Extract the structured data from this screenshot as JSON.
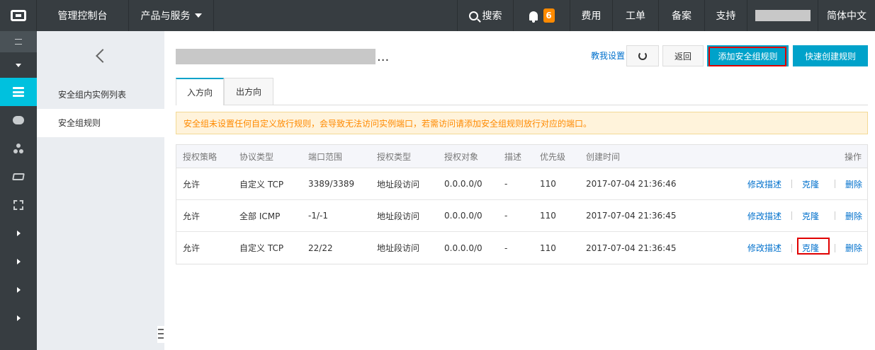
{
  "topbar": {
    "console": "管理控制台",
    "products": "产品与服务",
    "search": "搜索",
    "notification_count": "6",
    "fee": "费用",
    "ticket": "工单",
    "record": "备案",
    "support": "支持",
    "language": "简体中文"
  },
  "subnav": {
    "items": [
      {
        "label": "安全组内实例列表"
      },
      {
        "label": "安全组规则"
      }
    ]
  },
  "main": {
    "title_suffix": "...",
    "help_link": "教我设置",
    "back_button": "返回",
    "add_rule_button": "添加安全组规则",
    "quick_rule_button": "快速创建规则",
    "tabs": [
      {
        "label": "入方向"
      },
      {
        "label": "出方向"
      }
    ],
    "notice": "安全组未设置任何自定义放行规则，会导致无法访问实例端口，若需访问请添加安全组规则放行对应的端口。"
  },
  "table": {
    "headers": [
      "授权策略",
      "协议类型",
      "端口范围",
      "授权类型",
      "授权对象",
      "描述",
      "优先级",
      "创建时间",
      "操作"
    ],
    "rows": [
      {
        "policy": "允许",
        "protocol": "自定义 TCP",
        "ports": "3389/3389",
        "auth_type": "地址段访问",
        "target": "0.0.0.0/0",
        "desc": "-",
        "priority": "110",
        "created": "2017-07-04 21:36:46"
      },
      {
        "policy": "允许",
        "protocol": "全部 ICMP",
        "ports": "-1/-1",
        "auth_type": "地址段访问",
        "target": "0.0.0.0/0",
        "desc": "-",
        "priority": "110",
        "created": "2017-07-04 21:36:45"
      },
      {
        "policy": "允许",
        "protocol": "自定义 TCP",
        "ports": "22/22",
        "auth_type": "地址段访问",
        "target": "0.0.0.0/0",
        "desc": "-",
        "priority": "110",
        "created": "2017-07-04 21:36:45"
      }
    ],
    "ops": {
      "edit": "修改描述",
      "clone": "克隆",
      "delete": "删除"
    }
  },
  "colors": {
    "topbar": "#373d41",
    "accent": "#00a2ca",
    "active_nav": "#00c1de",
    "link": "#0070cc",
    "highlight": "#e00000",
    "notice_text": "#ff8a00"
  }
}
